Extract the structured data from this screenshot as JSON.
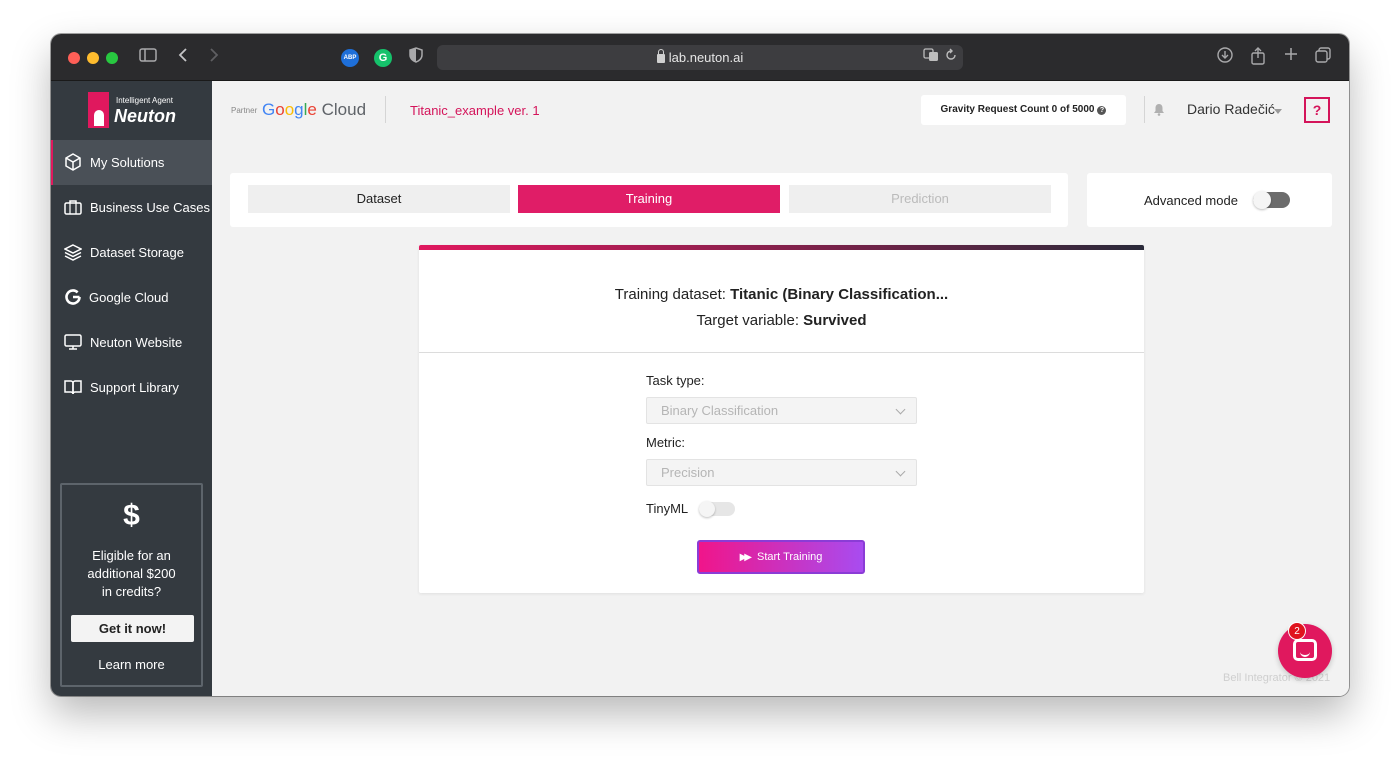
{
  "browser": {
    "url": "lab.neuton.ai",
    "extensions": [
      "ABP",
      "G"
    ]
  },
  "brand": {
    "tagline": "Intelligent Agent",
    "name": "Neuton"
  },
  "sidebar": {
    "items": [
      {
        "label": "My Solutions",
        "icon": "cube-icon",
        "active": true
      },
      {
        "label": "Business Use Cases",
        "icon": "briefcase-icon"
      },
      {
        "label": "Dataset Storage",
        "icon": "layers-icon"
      },
      {
        "label": "Google Cloud",
        "icon": "google-icon"
      },
      {
        "label": "Neuton Website",
        "icon": "monitor-icon"
      },
      {
        "label": "Support Library",
        "icon": "book-icon"
      }
    ],
    "promo": {
      "symbol": "$",
      "line1": "Eligible for an",
      "line2": "additional $200",
      "line3": "in credits?",
      "button": "Get it now!",
      "link": "Learn more"
    }
  },
  "header": {
    "partner": "Partner",
    "partner_brand": "Google Cloud",
    "project": "Titanic_example ver. 1",
    "gravity": "Gravity Request Count 0 of 5000",
    "user": "Dario Radečić",
    "help": "?"
  },
  "steps": {
    "items": [
      "Dataset",
      "Training",
      "Prediction"
    ],
    "active": "Training"
  },
  "advanced_mode": {
    "label": "Advanced mode",
    "enabled": false
  },
  "card": {
    "dataset_label": "Training dataset:",
    "dataset_value": "Titanic (Binary Classification...",
    "target_label": "Target variable:",
    "target_value": "Survived",
    "task_type_label": "Task type:",
    "task_type_value": "Binary Classification",
    "metric_label": "Metric:",
    "metric_value": "Precision",
    "tinyml_label": "TinyML",
    "tinyml_enabled": false,
    "start_button": "Start Training"
  },
  "footer": {
    "copyright": "Bell Integrator © 2021"
  },
  "chat": {
    "badge": "2"
  },
  "colors": {
    "accent": "#e0185e",
    "sidebar": "#343a40"
  }
}
